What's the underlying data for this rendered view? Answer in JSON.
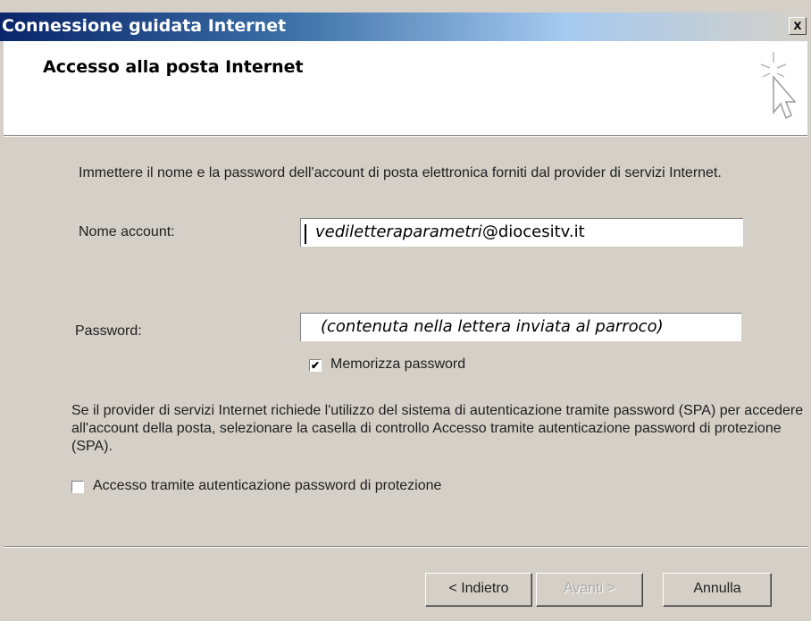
{
  "window": {
    "title": "Connessione guidata Internet",
    "close_label": "x"
  },
  "header": {
    "title": "Accesso alla posta Internet"
  },
  "content": {
    "intro": "Immettere il nome e la password dell'account di posta elettronica forniti dal provider di servizi Internet.",
    "account_label": "Nome account:",
    "account_value_italic": "vediletteraparametri",
    "account_value_domain": "@diocesitv.it",
    "password_label": "Password:",
    "password_value": "(contenuta nella lettera inviata al parroco)",
    "remember_password_label": "Memorizza password",
    "remember_password_checked": true,
    "spa_text": "Se il provider di servizi Internet richiede l'utilizzo del sistema di autenticazione tramite password (SPA) per accedere all'account della posta, selezionare la casella di controllo Accesso tramite autenticazione password di protezione (SPA).",
    "spa_checkbox_label": "Accesso tramite autenticazione password di protezione",
    "spa_checked": false
  },
  "buttons": {
    "back": "< Indietro",
    "next": "Avanti >",
    "cancel": "Annulla"
  }
}
